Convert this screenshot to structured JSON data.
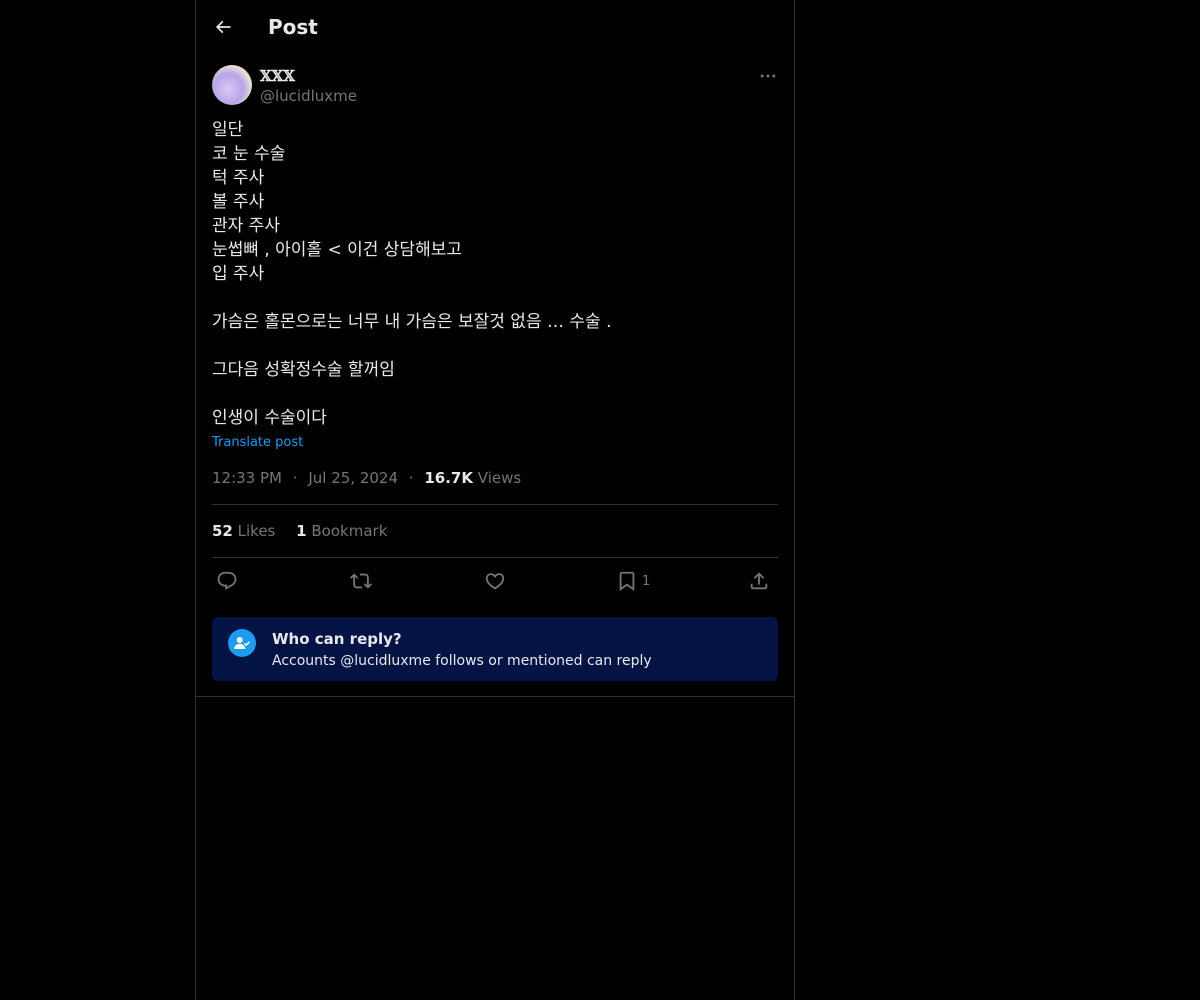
{
  "header": {
    "title": "Post"
  },
  "post": {
    "display_name": "𝕏𝕏𝕏",
    "handle": "@lucidluxme",
    "text": "일단\n코 눈 수술\n턱 주사\n볼 주사\n관자 주사\n눈썹뼈 , 아이홀 < 이건 상담해보고\n입 주사\n\n가슴은 홀몬으로는 너무 내 가슴은 보잘것 없음 … 수술 .\n\n그다음 성확정수술 할꺼임\n\n인생이 수술이다",
    "translate_label": "Translate post",
    "time": "12:33 PM",
    "separator": "·",
    "date": "Jul 25, 2024",
    "views_count": "16.7K",
    "views_label": "Views"
  },
  "stats": {
    "likes_count": "52",
    "likes_label": "Likes",
    "bookmarks_count": "1",
    "bookmarks_label": "Bookmark"
  },
  "actions": {
    "bookmark_count": "1"
  },
  "reply_settings": {
    "title": "Who can reply?",
    "description": "Accounts @lucidluxme follows or mentioned can reply"
  },
  "colors": {
    "background": "#000000",
    "border": "#2f3336",
    "text_primary": "#e7e9ea",
    "text_secondary": "#71767b",
    "accent": "#1d9bf0",
    "reply_box_bg": "#031444"
  }
}
